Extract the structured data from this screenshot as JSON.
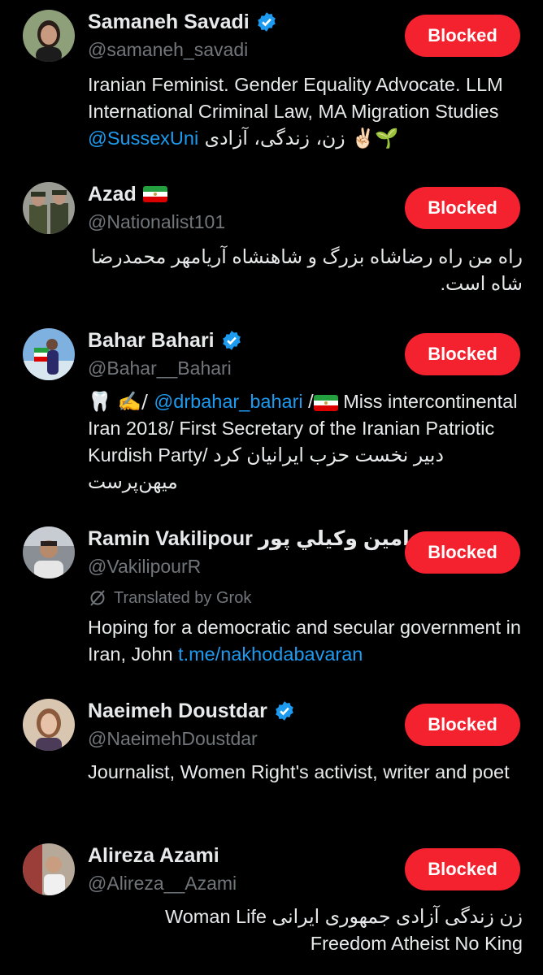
{
  "blocked_label": "Blocked",
  "accounts": [
    {
      "name": "Samaneh Savadi",
      "handle": "@samaneh_savadi",
      "verified": true,
      "bio_1": "Iranian Feminist. Gender Equality Advocate. LLM International Criminal Law, MA Migration Studies ",
      "bio_link": "@SussexUni",
      "bio_2": " زن، زندگی، آزادی ✌🏻🌱"
    },
    {
      "name": "Azad",
      "name_flag": "iran-flag",
      "handle": "@Nationalist101",
      "bio": "راه من راه رضاشاه بزرگ و شاهنشاه آریامهر محمدرضا شاه است."
    },
    {
      "name": "Bahar Bahari",
      "handle": "@Bahar__Bahari",
      "verified": true,
      "bio_1": "🦷 ✍️/ ",
      "bio_link": "@drbahar_bahari",
      "bio_2": " /",
      "bio_3": " Miss intercontinental Iran 2018/ First Secretary of the Iranian Patriotic Kurdish Party/ دبیر نخست حزب ایرانیان کرد میهن‌پرست"
    },
    {
      "name": "Ramin Vakilipour رامين وكيلي پور",
      "handle": "@VakilipourR",
      "translated": "Translated by Grok",
      "bio_1": "Hoping for a democratic and secular government in Iran, John ",
      "bio_link": "t.me/nakhodabavaran"
    },
    {
      "name": "Naeimeh Doustdar",
      "handle": "@NaeimehDoustdar",
      "verified": true,
      "bio": "Journalist, Women Right's activist, writer and poet"
    },
    {
      "name": "Alireza Azami",
      "handle": "@Alireza__Azami",
      "bio": "زن زندگی آزادی جمهوری ایرانی Woman Life Freedom Atheist No King"
    }
  ],
  "colors": {
    "blocked_red": "#f4212e",
    "link_blue": "#1d9bf0",
    "muted": "#71767b",
    "verified_blue": "#1d9bf0"
  }
}
